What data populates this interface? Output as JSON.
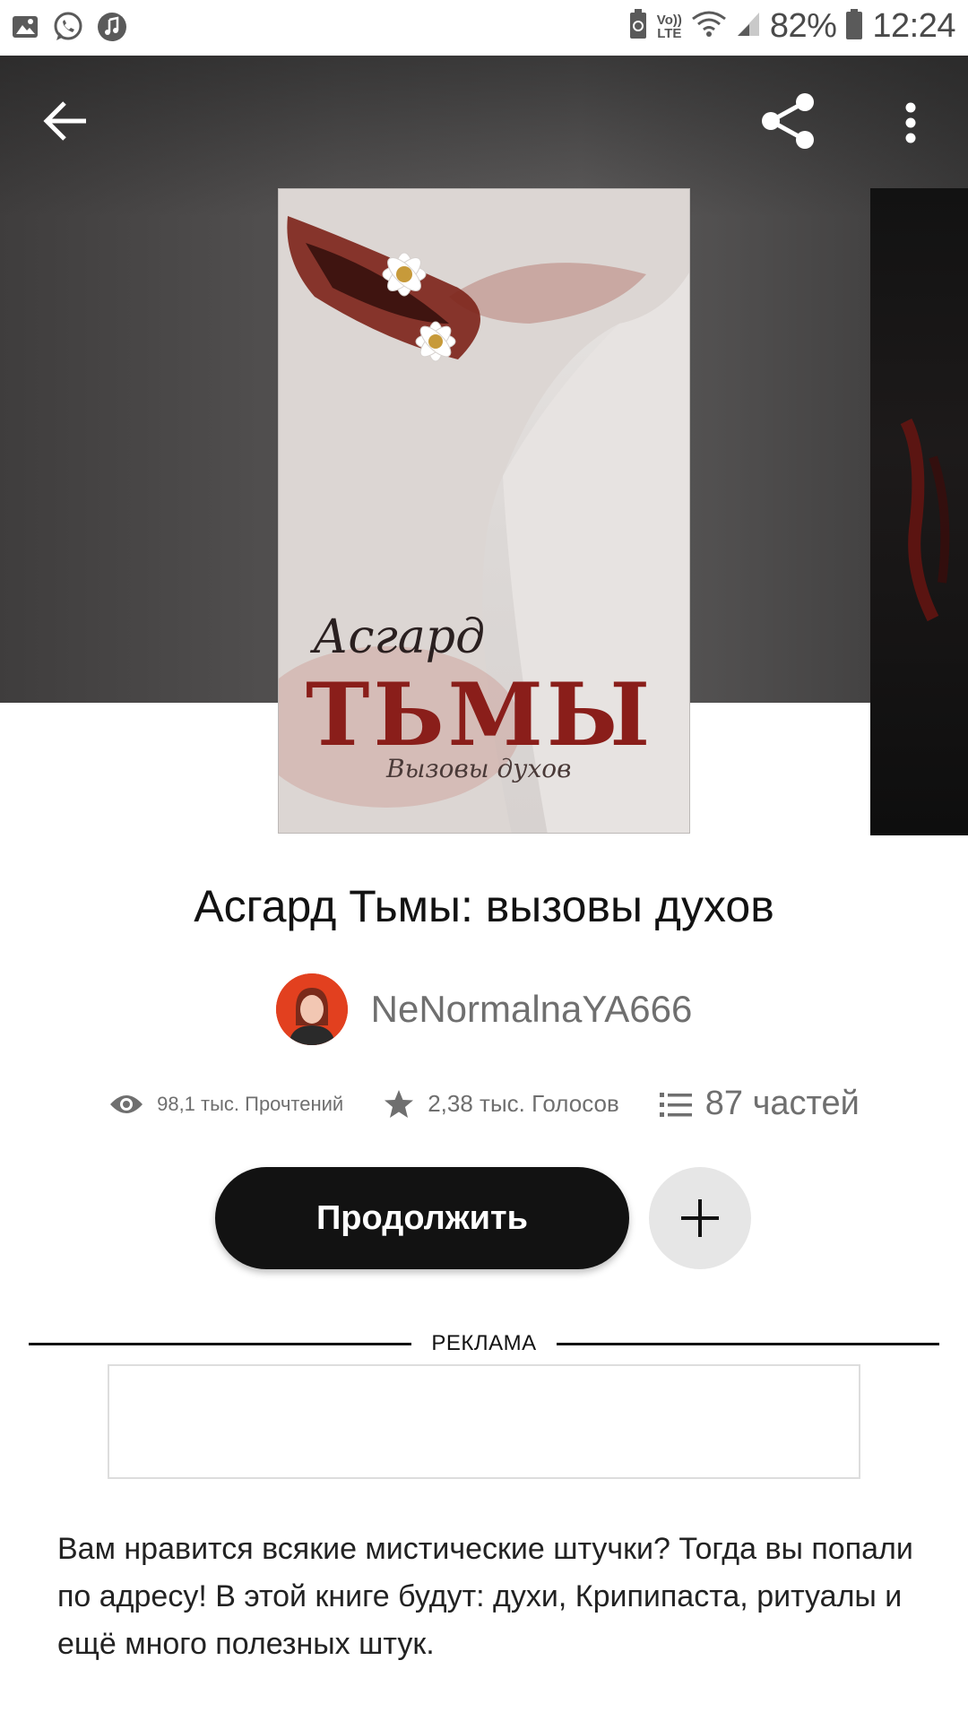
{
  "status_bar": {
    "left_icons": [
      "gallery-icon",
      "whatsapp-icon",
      "music-icon"
    ],
    "network_label_top": "Vo))",
    "network_label_bottom": "LTE",
    "battery_percent": "82%",
    "time": "12:24"
  },
  "app_bar": {
    "icons": [
      "arrow-back-icon",
      "share-icon",
      "more-vert-icon"
    ]
  },
  "cover": {
    "title_script": "Асгард",
    "title_main": "ТЬМЫ",
    "subtitle_script": "Вызовы духов"
  },
  "story": {
    "title": "Асгард Тьмы: вызовы духов",
    "author": "NeNormalnaYA666",
    "reads": "98,1 тыс. Прочтений",
    "votes": "2,38 тыс. Голосов",
    "parts": "87 частей",
    "description": "Вам нравится всякие мистические штучки? Тогда вы попали по адресу! В этой книге будут: духи, Крипипаста, ритуалы и ещё много полезных штук."
  },
  "actions": {
    "continue_label": "Продолжить"
  },
  "ad": {
    "label": "РЕКЛАМА"
  },
  "colors": {
    "primary_button": "#121212",
    "secondary_button": "#e6e6e6",
    "avatar_bg": "#e2401f",
    "muted_text": "#6f6f6f"
  }
}
